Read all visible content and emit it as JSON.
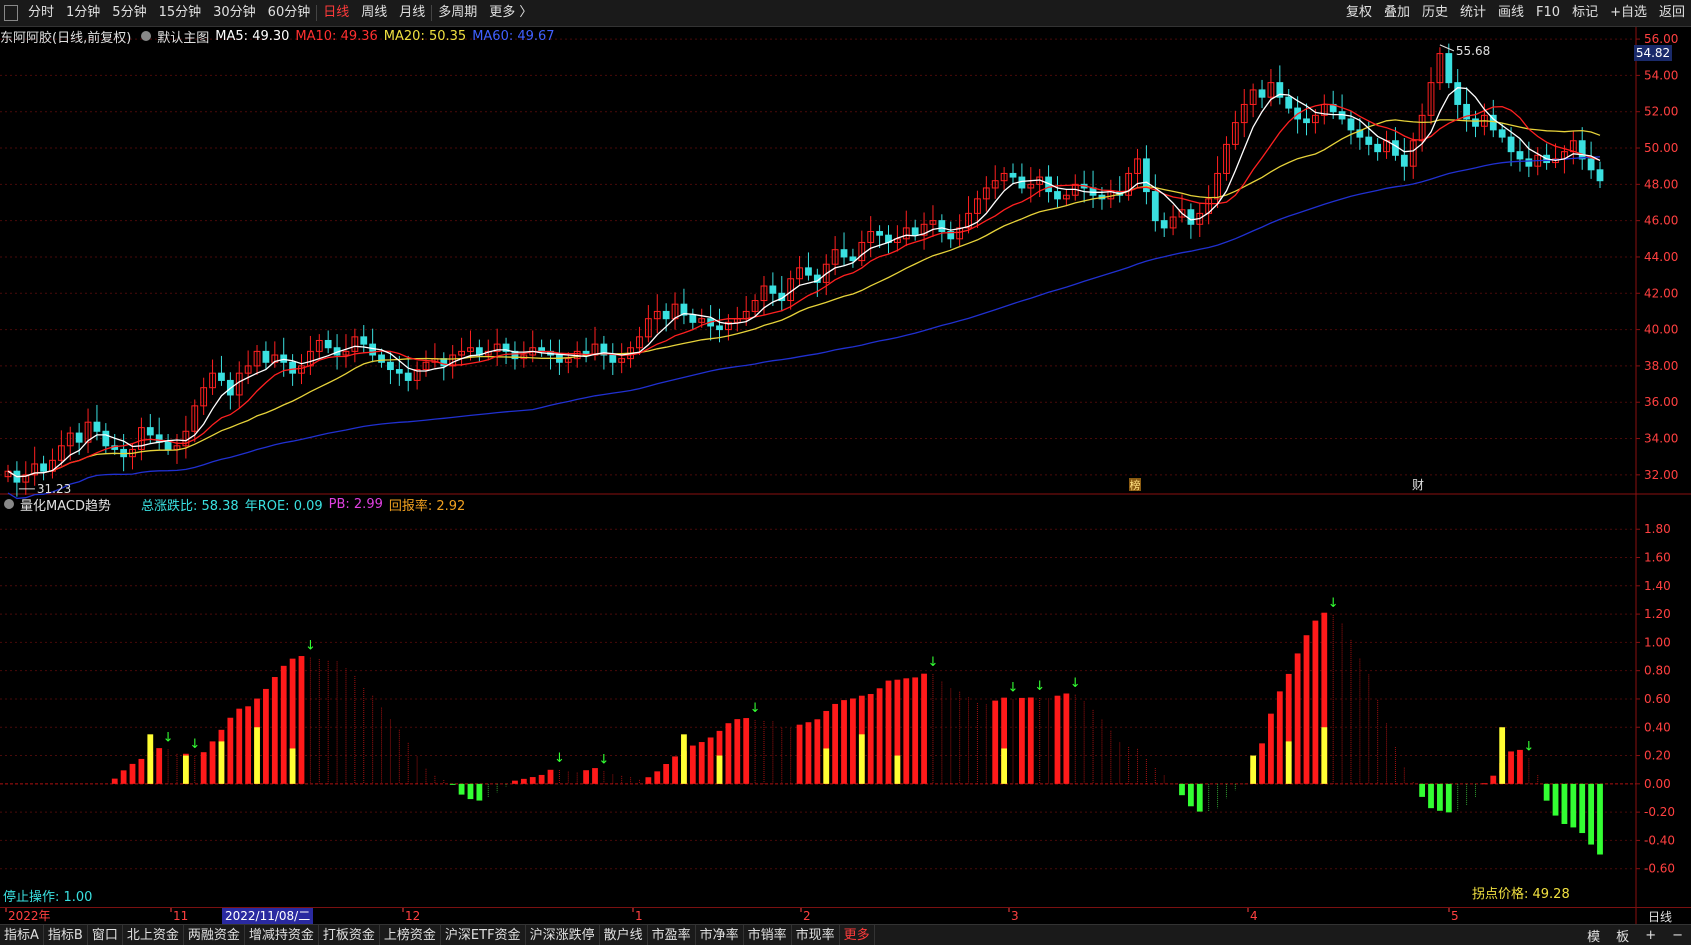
{
  "toolbar": {
    "periods": [
      "分时",
      "1分钟",
      "5分钟",
      "15分钟",
      "30分钟",
      "60分钟",
      "日线",
      "周线",
      "月线",
      "多周期",
      "更多 〉"
    ],
    "active_period": "日线",
    "tools": [
      "复权",
      "叠加",
      "历史",
      "统计",
      "画线",
      "F10",
      "标记",
      "+自选",
      "返回"
    ]
  },
  "main_chart": {
    "stock": "东阿阿胶(日线,前复权)",
    "template": "默认主图",
    "ma5": "MA5: 49.30",
    "ma10": "MA10: 49.36",
    "ma20": "MA20: 50.35",
    "ma60": "MA60: 49.67",
    "high_label": "55.68",
    "low_label": "31.23",
    "current_price": "54.82",
    "marker1": "榜",
    "marker2": "财",
    "yaxis": [
      "56.00",
      "54.00",
      "52.00",
      "50.00",
      "48.00",
      "46.00",
      "44.00",
      "42.00",
      "40.00",
      "38.00",
      "36.00",
      "34.00",
      "32.00"
    ]
  },
  "indicator": {
    "name": "量化MACD趋势",
    "total_ratio": "总涨跌比: 58.38",
    "roe": "年ROE: 0.09",
    "pb": "PB: 2.99",
    "return": "回报率: 2.92",
    "stop": "停止操作: 1.00",
    "turn_price": "拐点价格: 49.28",
    "yaxis": [
      "1.80",
      "1.60",
      "1.40",
      "1.20",
      "1.00",
      "0.80",
      "0.60",
      "0.40",
      "0.20",
      "0.00",
      "-0.20",
      "-0.40",
      "-0.60"
    ]
  },
  "time_axis": {
    "labels": [
      "2022年",
      "11",
      "12",
      "1",
      "2",
      "3",
      "4",
      "5"
    ],
    "cursor_date": "2022/11/08/二",
    "period": "日线"
  },
  "bottombar": {
    "items": [
      "指标A",
      "指标B",
      "窗口",
      "北上资金",
      "两融资金",
      "增减持资金",
      "打板资金",
      "上榜资金",
      "沪深ETF资金",
      "沪深涨跌停",
      "散户线",
      "市盈率",
      "市净率",
      "市销率",
      "市现率",
      "更多"
    ],
    "right": [
      "模",
      "板",
      "+",
      "−"
    ]
  },
  "colors": {
    "up": "#ff2020",
    "down": "#3ae0e0",
    "ma5": "#ffffff",
    "ma10": "#ff2020",
    "ma20": "#e6d23a",
    "ma60": "#2030d0",
    "macd_red": "#ff1a1a",
    "macd_yellow": "#ffff33",
    "macd_green": "#33ff33"
  },
  "chart_data": {
    "type": "candlestick",
    "title": "东阿阿胶(日线,前复权)",
    "ylim": [
      31,
      56.5
    ],
    "close": [
      32.2,
      31.6,
      32.0,
      32.6,
      32.2,
      32.8,
      33.6,
      34.3,
      33.8,
      34.9,
      34.4,
      33.6,
      33.4,
      33.0,
      33.4,
      34.6,
      34.2,
      33.8,
      33.4,
      33.6,
      34.4,
      35.8,
      36.8,
      37.6,
      37.2,
      36.4,
      37.6,
      38.0,
      38.8,
      38.2,
      38.6,
      38.2,
      37.6,
      38.0,
      38.8,
      39.4,
      39.0,
      38.6,
      38.8,
      39.6,
      39.2,
      38.6,
      38.2,
      37.8,
      37.6,
      37.2,
      37.8,
      38.2,
      38.4,
      38.0,
      38.6,
      38.8,
      39.0,
      38.6,
      38.8,
      39.2,
      38.8,
      38.4,
      38.6,
      39.0,
      38.8,
      38.6,
      38.2,
      38.4,
      38.8,
      38.6,
      39.2,
      38.6,
      38.2,
      38.4,
      39.0,
      39.6,
      40.6,
      41.0,
      40.6,
      41.4,
      40.8,
      40.4,
      40.6,
      40.2,
      40.0,
      40.4,
      40.6,
      41.0,
      41.6,
      42.4,
      42.0,
      41.6,
      42.8,
      43.4,
      43.0,
      42.6,
      43.6,
      44.4,
      44.0,
      43.8,
      44.8,
      45.4,
      45.2,
      44.8,
      45.0,
      45.6,
      45.2,
      45.8,
      46.0,
      45.4,
      45.0,
      45.6,
      46.4,
      47.2,
      47.8,
      48.2,
      48.6,
      48.4,
      47.8,
      48.0,
      48.4,
      47.6,
      47.2,
      47.4,
      48.0,
      47.8,
      47.4,
      47.2,
      47.6,
      47.4,
      48.6,
      49.4,
      47.6,
      46.0,
      45.6,
      46.2,
      46.6,
      45.8,
      46.4,
      47.2,
      48.6,
      50.2,
      51.4,
      52.4,
      53.2,
      52.8,
      53.6,
      52.8,
      52.2,
      51.6,
      51.4,
      51.8,
      52.4,
      52.0,
      51.6,
      51.0,
      50.6,
      50.2,
      49.8,
      50.4,
      49.6,
      49.0,
      50.4,
      51.8,
      53.6,
      55.2,
      53.6,
      52.4,
      51.6,
      51.2,
      51.8,
      51.0,
      50.6,
      49.8,
      49.4,
      49.0,
      49.6,
      49.2,
      49.4,
      49.8,
      50.4,
      49.4,
      48.8,
      48.2
    ]
  }
}
